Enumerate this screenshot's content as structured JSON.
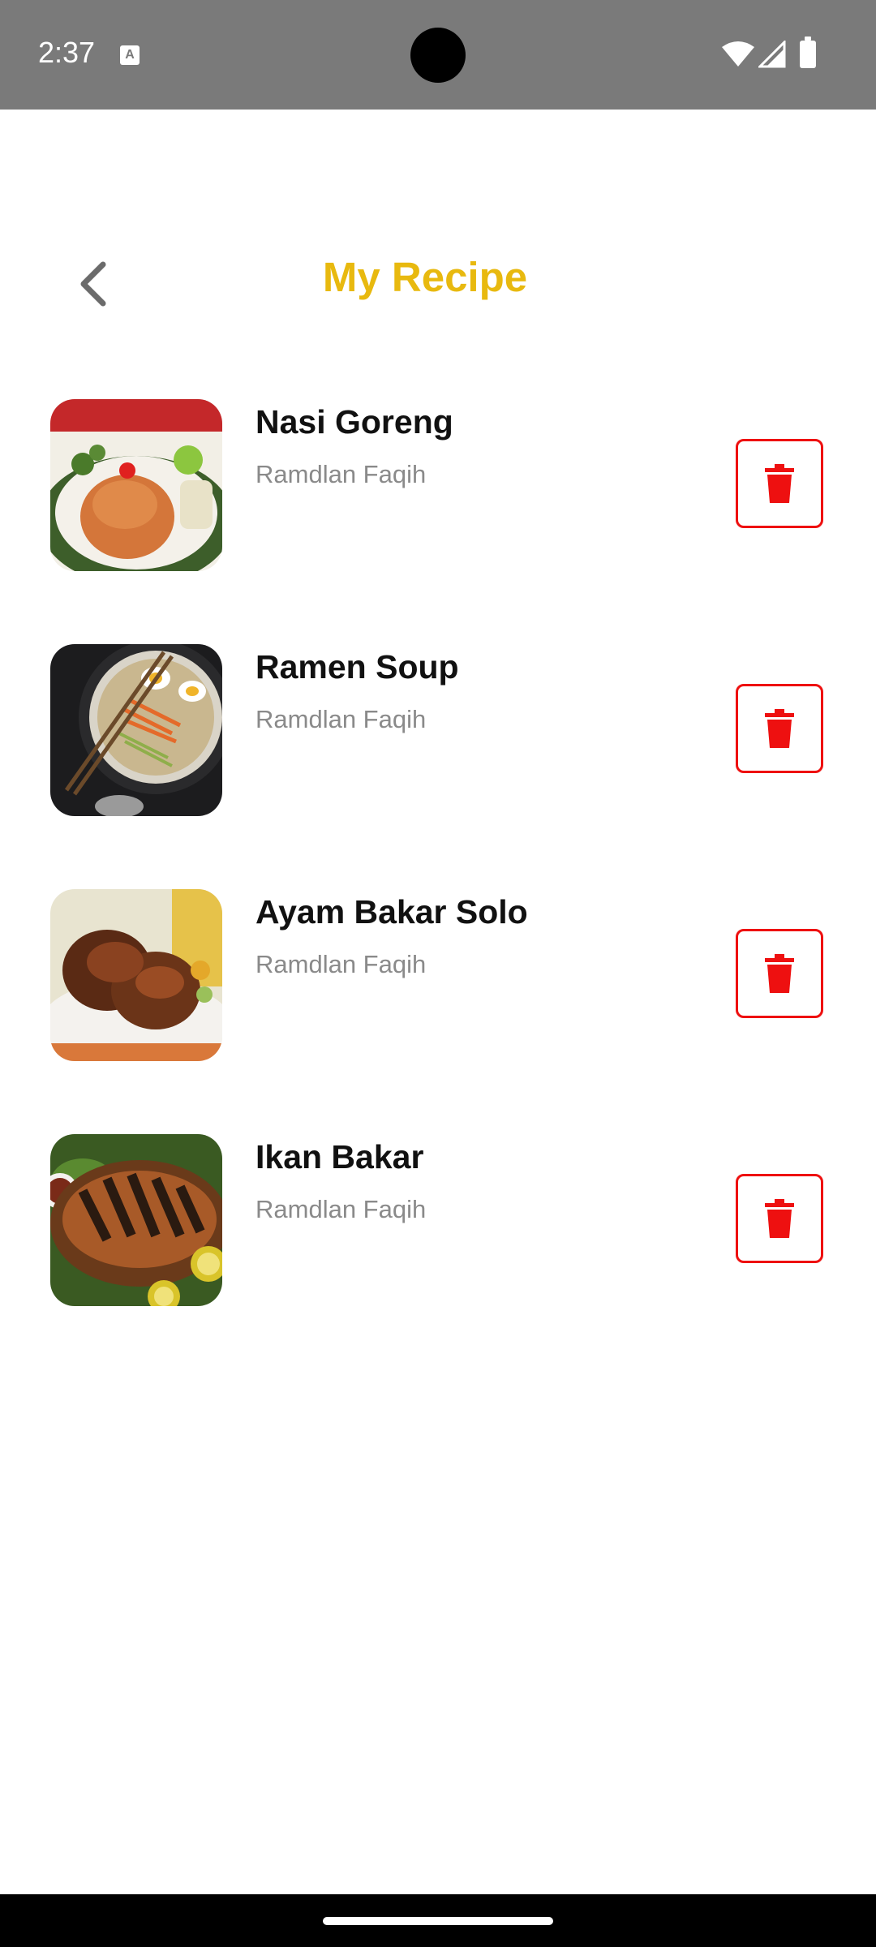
{
  "status_bar": {
    "time": "2:37"
  },
  "header": {
    "title": "My Recipe"
  },
  "recipes": [
    {
      "name": "Nasi Goreng",
      "author": "Ramdlan Faqih"
    },
    {
      "name": "Ramen Soup",
      "author": "Ramdlan Faqih"
    },
    {
      "name": "Ayam Bakar Solo",
      "author": "Ramdlan Faqih"
    },
    {
      "name": "Ikan Bakar",
      "author": "Ramdlan Faqih"
    }
  ],
  "icons": {
    "back": "chevron-left-icon",
    "delete": "trash-icon"
  },
  "colors": {
    "accent": "#e8b90f",
    "delete": "#ee1010",
    "status_bar": "#7a7a7a"
  }
}
